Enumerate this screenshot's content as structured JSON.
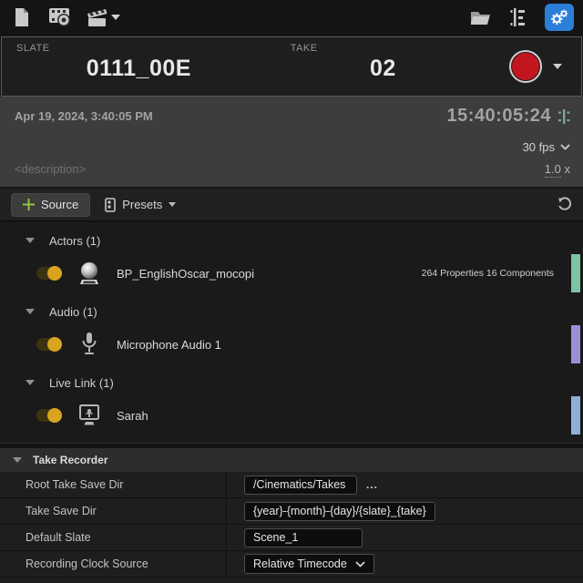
{
  "toolbar": {
    "icons": {
      "new_take": "new-take-icon",
      "review_recording": "review-recording-icon",
      "clapperboard": "clapperboard-icon",
      "browse": "browse-folder-icon",
      "sequence": "sequence-icon",
      "settings": "settings-gear-icon"
    },
    "settings_active_color": "#2b7fd9"
  },
  "slate": {
    "slate_label": "SLATE",
    "slate_value": "0111_00E",
    "take_label": "TAKE",
    "take_value": "02",
    "record_color": "#c2161f"
  },
  "session": {
    "datetime": "Apr 19, 2024, 3:40:05 PM",
    "timecode": "15:40:05:24",
    "framerate": "30 fps",
    "description_placeholder": "<description>",
    "speed_value": "1.0",
    "speed_suffix": "x"
  },
  "source_toolbar": {
    "add_source_label": "Source",
    "presets_label": "Presets"
  },
  "sources": {
    "groups": [
      {
        "label": "Actors (1)",
        "items": [
          {
            "name": "BP_EnglishOscar_mocopi",
            "meta": "264 Properties 16 Components",
            "icon": "actor-sphere-icon",
            "bar_color": "#7cc4a4",
            "bar_style": "background:#7cc4a4"
          }
        ]
      },
      {
        "label": "Audio (1)",
        "items": [
          {
            "name": "Microphone Audio 1",
            "meta": "",
            "icon": "microphone-icon",
            "bar_color": "#9d8fd6",
            "bar_style": "background:#9d8fd6"
          }
        ]
      },
      {
        "label": "Live Link (1)",
        "items": [
          {
            "name": "Sarah",
            "meta": "",
            "icon": "live-link-monitor-icon",
            "bar_color": "#8fb0d6",
            "bar_style": "background:#8fb0d6"
          }
        ]
      }
    ]
  },
  "details": {
    "header": "Take Recorder",
    "rows": [
      {
        "label": "Root Take Save Dir",
        "value": "/Cinematics/Takes",
        "control": "text-with-ellipsis",
        "ellipsis": "..."
      },
      {
        "label": "Take Save Dir",
        "value": "{year}-{month}-{day}/{slate}_{take}",
        "control": "text"
      },
      {
        "label": "Default Slate",
        "value": "Scene_1",
        "control": "text"
      },
      {
        "label": "Recording Clock Source",
        "value": "Relative Timecode",
        "control": "dropdown"
      }
    ]
  }
}
